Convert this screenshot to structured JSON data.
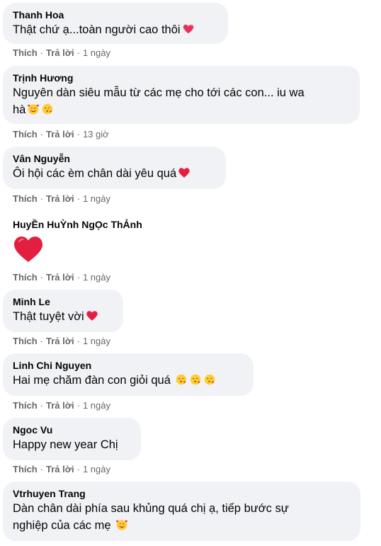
{
  "actions": {
    "like_label": "Thích",
    "reply_label": "Trả lời",
    "separator": "·"
  },
  "comments": [
    {
      "author": "Thanh Hoa",
      "text": "Thật chứ ạ...toàn người cao thôi",
      "emojis": [
        "sparkling-heart-icon"
      ],
      "time": "1 ngày"
    },
    {
      "author": "Trịnh Hương",
      "text": "Nguyên dàn siêu mẫu từ các mẹ cho tới các con... iu wa",
      "text2": "hà",
      "emojis": [
        "smiling-face-with-hearts-icon",
        "face-blowing-kiss-icon"
      ],
      "time": "13 giờ"
    },
    {
      "author": "Vân Nguyễn",
      "text": "Ôi hội các èm chân dài yêu quá",
      "emojis": [
        "red-heart-icon"
      ],
      "time": "1 ngày"
    },
    {
      "author": "HuyỀn HuỲnh NgỌc ThẢnh",
      "text": "",
      "emojis": [
        "red-heart-icon"
      ],
      "time": "1 ngày"
    },
    {
      "author": "Minh Le",
      "text": "Thật tuyệt vời",
      "emojis": [
        "red-heart-icon"
      ],
      "time": "1 ngày"
    },
    {
      "author": "Linh Chi Nguyen",
      "text": "Hai mẹ chăm đàn con giỏi quá",
      "emojis": [
        "face-blowing-kiss-icon",
        "face-blowing-kiss-icon",
        "face-blowing-kiss-icon"
      ],
      "time": "1 ngày"
    },
    {
      "author": "Ngoc Vu",
      "text": "Happy new year Chị",
      "emojis": [],
      "time": "1 ngày"
    },
    {
      "author": "Vtrhuyen Trang",
      "text": "Dàn chân dài phía sau khủng quá chị ạ, tiếp bước sự",
      "text2": "nghiệp của các mẹ",
      "emojis": [
        "smiling-face-with-hearts-icon"
      ],
      "time": ""
    }
  ],
  "colors": {
    "bubble": "#f0f2f5",
    "meta": "#65676b",
    "text": "#050505",
    "heart": "#e41e3f"
  }
}
